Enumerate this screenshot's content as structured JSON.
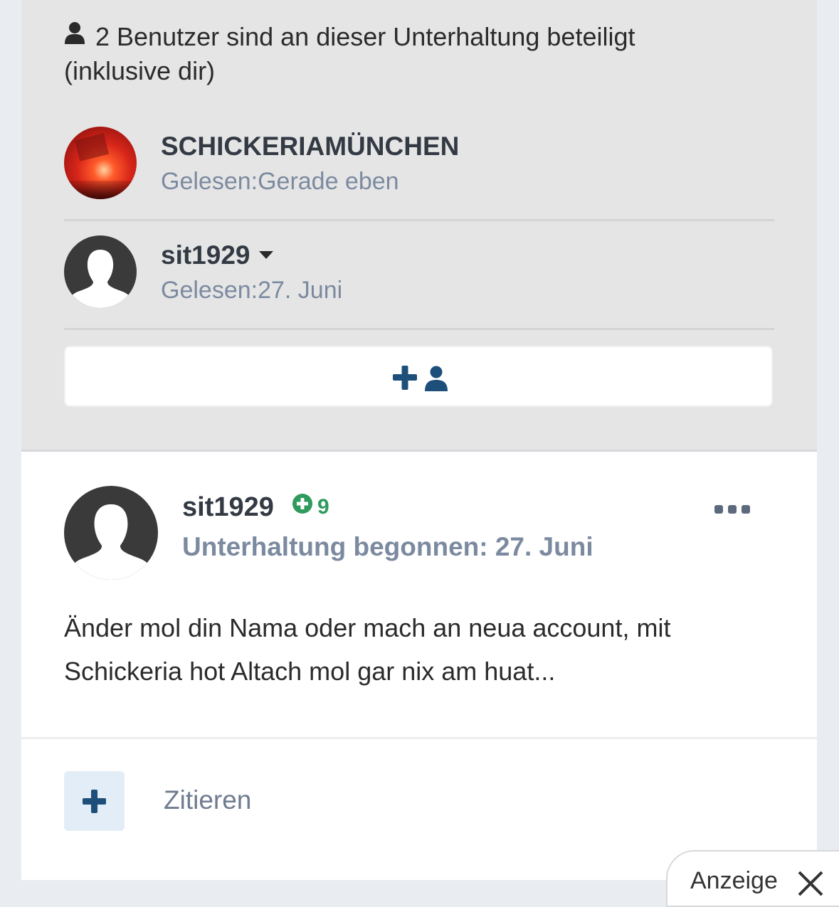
{
  "participants": {
    "header": "2 Benutzer sind an dieser Unterhaltung beteiligt (inklusive dir)",
    "list": [
      {
        "name": "SCHICKERIAMÜNCHEN",
        "read": "Gelesen:Gerade eben",
        "avatar": "red-flare-photo"
      },
      {
        "name": "sit1929",
        "read": "Gelesen:27. Juni",
        "avatar": "default-user-silhouette"
      }
    ],
    "add_button_icons": [
      "plus-icon",
      "user-icon"
    ]
  },
  "message": {
    "author": "sit1929",
    "reputation": "9",
    "meta": "Unterhaltung begonnen: 27. Juni",
    "body": "Änder mol din Nama oder mach an neua account, mit Schickeria hot Altach mol gar nix am huat...",
    "quote_label": "Zitieren"
  },
  "ad": {
    "label": "Anzeige"
  },
  "colors": {
    "panel_bg": "#e5e5e5",
    "accent_blue": "#1d4f7a",
    "muted_text": "#7c8aa0",
    "reputation_green": "#2e9a5c"
  }
}
